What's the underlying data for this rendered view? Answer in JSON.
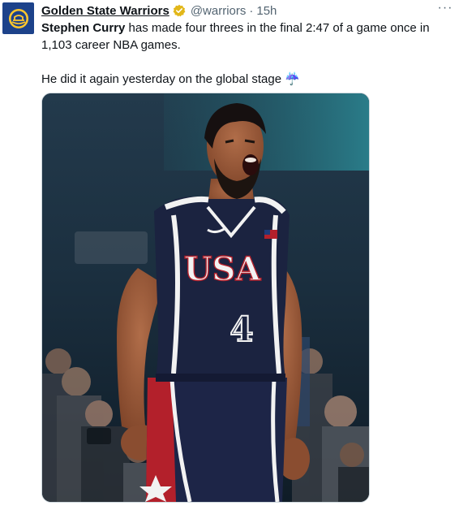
{
  "tweet": {
    "author_name": "Golden State Warriors",
    "handle": "@warriors",
    "separator": "·",
    "time": "15h",
    "more_label": "···",
    "verified_icon": "verified-badge-icon",
    "avatar_icon": "warriors-logo",
    "text_line1_mention": "Stephen Curry",
    "text_line1_rest": " has made four threes in the final 2:47 of a game once in 1,103 career NBA games.",
    "text_line2": "He did it again yesterday on the global stage ☔"
  },
  "media": {
    "jersey_text": "USA",
    "jersey_number": "4",
    "colors": {
      "jersey": "#1b2340",
      "trim": "#f2f2f2",
      "red": "#b3202b",
      "skin": "#9c5b3c"
    }
  }
}
